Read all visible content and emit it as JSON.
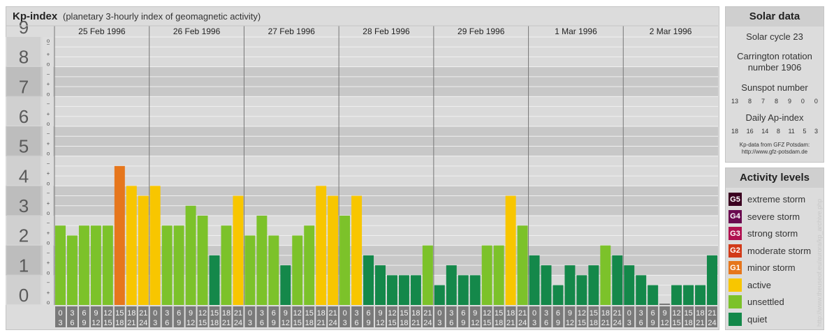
{
  "header": {
    "title": "Kp-index",
    "subtitle": "(planetary 3-hourly index of geomagnetic activity)"
  },
  "chart_data": {
    "type": "bar",
    "y_axis_labels": [
      "0",
      "1",
      "2",
      "3",
      "4",
      "5",
      "6",
      "7",
      "8",
      "9"
    ],
    "minor_tick_symbols": [
      "o",
      "+",
      "−"
    ],
    "ylim": [
      0,
      9
    ],
    "days": [
      "25 Feb 1996",
      "26 Feb 1996",
      "27 Feb 1996",
      "28 Feb 1996",
      "29 Feb 1996",
      "1 Mar 1996",
      "2 Mar 1996"
    ],
    "interval_start_hours": [
      "0",
      "3",
      "6",
      "9",
      "12",
      "15",
      "18",
      "21"
    ],
    "interval_end_hours": [
      "3",
      "6",
      "9",
      "12",
      "15",
      "18",
      "21",
      "24"
    ],
    "kp_values": [
      [
        2.667,
        2.333,
        2.667,
        2.667,
        2.667,
        4.667,
        4.0,
        3.667
      ],
      [
        4.0,
        2.667,
        2.667,
        3.333,
        3.0,
        1.667,
        2.667,
        3.667
      ],
      [
        2.333,
        3.0,
        2.333,
        1.333,
        2.333,
        2.667,
        4.0,
        3.667
      ],
      [
        3.0,
        3.667,
        1.667,
        1.333,
        1.0,
        1.0,
        1.0,
        2.0
      ],
      [
        0.667,
        1.333,
        1.0,
        1.0,
        2.0,
        2.0,
        3.667,
        2.667
      ],
      [
        1.667,
        1.333,
        0.667,
        1.333,
        1.0,
        1.333,
        2.0,
        1.667
      ],
      [
        1.333,
        1.0,
        0.667,
        0.0,
        0.667,
        0.667,
        0.667,
        1.667
      ]
    ]
  },
  "colors": {
    "quiet": "#14884a",
    "unsettled": "#7cc22a",
    "active": "#f8c600",
    "minor_storm": "#e6761c",
    "moderate_storm": "#d23a18",
    "strong_storm": "#b01050",
    "severe_storm": "#6a0a50",
    "extreme_storm": "#3a0020"
  },
  "solar_data": {
    "title": "Solar data",
    "solar_cycle": "Solar cycle 23",
    "carrington_line1": "Carrington rotation",
    "carrington_line2": "number 1906",
    "sunspot_label": "Sunspot number",
    "sunspot_values": [
      "13",
      "8",
      "7",
      "8",
      "9",
      "0",
      "0"
    ],
    "ap_label": "Daily Ap-index",
    "ap_values": [
      "18",
      "16",
      "14",
      "8",
      "11",
      "5",
      "3"
    ],
    "credit_line1": "Kp-data from GFZ Potsdam:",
    "credit_line2": "http://www.gfz-potsdam.de"
  },
  "activity_levels": {
    "title": "Activity levels",
    "items": [
      {
        "badge": "G5",
        "label": "extreme storm",
        "color": "#3a0020"
      },
      {
        "badge": "G4",
        "label": "severe storm",
        "color": "#6a0a50"
      },
      {
        "badge": "G3",
        "label": "strong storm",
        "color": "#b01050"
      },
      {
        "badge": "G2",
        "label": "moderate storm",
        "color": "#d23a18"
      },
      {
        "badge": "G1",
        "label": "minor storm",
        "color": "#e6761c"
      },
      {
        "badge": "",
        "label": "active",
        "color": "#f8c600"
      },
      {
        "badge": "",
        "label": "unsettled",
        "color": "#7cc22a"
      },
      {
        "badge": "",
        "label": "quiet",
        "color": "#14884a"
      }
    ]
  },
  "watermark": "http://www.theuseof.eu/aurora/kp_archive.php"
}
